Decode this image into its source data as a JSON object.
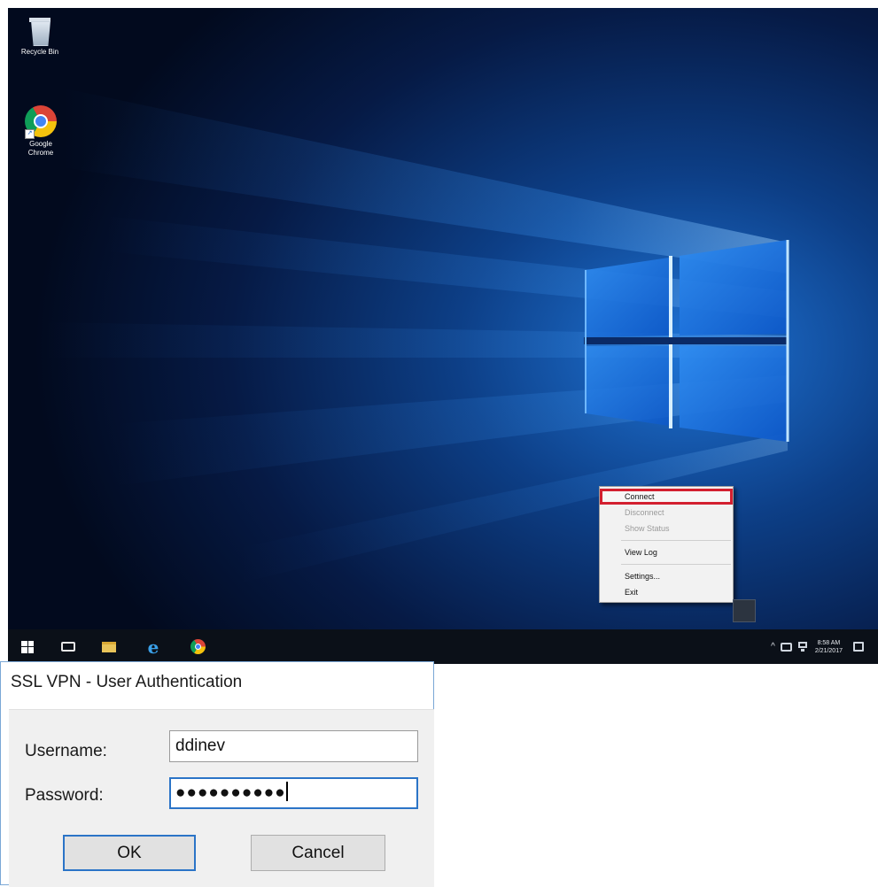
{
  "desktop": {
    "icons": [
      {
        "label": "Recycle Bin",
        "icon": "recycle-bin-icon"
      },
      {
        "label": "Google Chrome",
        "icon": "chrome-icon"
      }
    ]
  },
  "context_menu": {
    "items": [
      {
        "label": "Connect",
        "enabled": true,
        "highlighted": true
      },
      {
        "label": "Disconnect",
        "enabled": false
      },
      {
        "label": "Show Status",
        "enabled": false
      },
      {
        "label": "View Log",
        "enabled": true
      },
      {
        "label": "Settings...",
        "enabled": true
      },
      {
        "label": "Exit",
        "enabled": true
      }
    ],
    "highlight_color": "#d32030"
  },
  "taskbar": {
    "pinned": [
      "windows-start-icon",
      "task-view-icon",
      "file-explorer-icon",
      "internet-explorer-icon",
      "chrome-icon"
    ],
    "clock": {
      "time": "8:58 AM",
      "date": "2/21/2017"
    }
  },
  "dialog": {
    "title": "SSL VPN - User Authentication",
    "username_label": "Username:",
    "username_value": "ddinev",
    "password_label": "Password:",
    "password_value": "●●●●●●●●●●",
    "ok_label": "OK",
    "cancel_label": "Cancel",
    "accent_color": "#2b74c7"
  }
}
